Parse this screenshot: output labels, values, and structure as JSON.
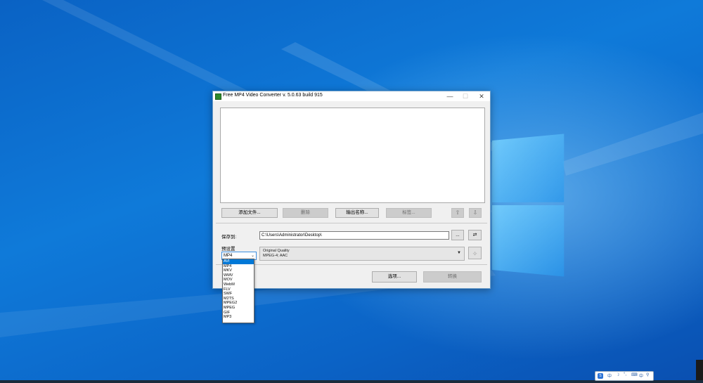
{
  "window": {
    "title": "Free MP4 Video Converter  v. 5.0.63 build 915",
    "controls": {
      "minimize": "—",
      "maximize": "☐",
      "close": "✕"
    }
  },
  "toolbar": {
    "add_files": "添加文件...",
    "delete": "删除",
    "output_name": "输出名称...",
    "tags": "标签...",
    "move_up_icon": "up-arrow-icon",
    "move_down_icon": "down-arrow-icon"
  },
  "output": {
    "save_to_label": "保存到:",
    "path": "C:\\Users\\Administrator\\Desktop\\",
    "browse": "...",
    "open_folder_icon": "folder-arrow-icon"
  },
  "preset": {
    "label": "预设置",
    "format": "MP4",
    "quality_title": "Original Quality",
    "quality_codecs": "MPEG-4; AAC"
  },
  "format_options": [
    "AVI",
    "MP4",
    "MKV",
    "WMV",
    "MOV",
    "WebM",
    "FLV",
    "SWF",
    "M2TS",
    "MPEG2",
    "MPEG",
    "GIF",
    "MP3"
  ],
  "format_selected_index": 0,
  "bottom": {
    "options": "选项...",
    "convert": "转换"
  },
  "ime": {
    "items": [
      "中",
      "☽",
      "°,",
      "⌨",
      "中",
      "⚲"
    ]
  },
  "colors": {
    "desktop": "#0b63c6",
    "selection": "#0078d7"
  }
}
